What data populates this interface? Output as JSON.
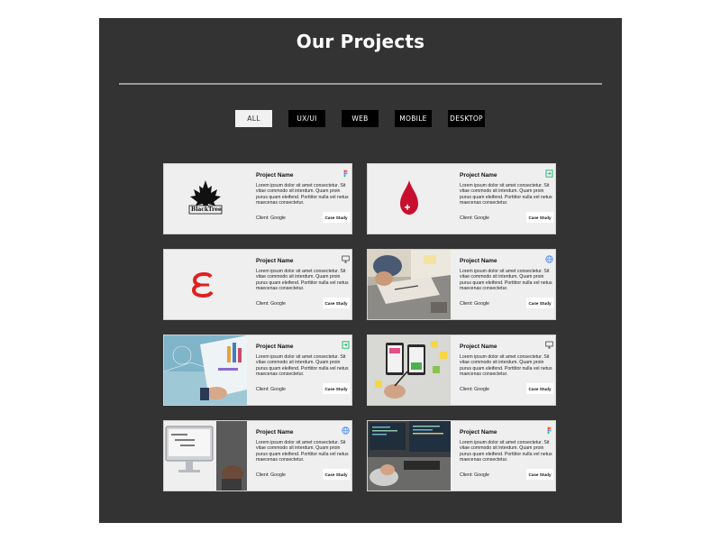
{
  "page": {
    "title": "Our Projects"
  },
  "filters": [
    {
      "label": "ALL",
      "active": true
    },
    {
      "label": "UX/UI",
      "active": false
    },
    {
      "label": "WEB",
      "active": false
    },
    {
      "label": "MOBILE",
      "active": false
    },
    {
      "label": "DESKTOP",
      "active": false
    }
  ],
  "colors": {
    "panel": "#333333",
    "card": "#efefef",
    "figma_red": "#f24e1e",
    "figma_blue": "#1abcfe",
    "figma_green": "#0acf83",
    "maple": "#111111",
    "drop": "#c8102e",
    "e_logo": "#e02020"
  },
  "projects": [
    {
      "name": "Project Name",
      "desc": "Lorem ipsum dolor sit amet consectetur. Sit vitae commodo sit interdum. Quam proin purus quam eleifend. Porttitor nulla vel netus maecenas consectetur.",
      "client": "Client: Google",
      "cta": "Case Study",
      "icon": "figma-icon",
      "thumb": "blacktree-logo",
      "logo_text": "BlackTree"
    },
    {
      "name": "Project Name",
      "desc": "Lorem ipsum dolor sit amet consectetur. Sit vitae commodo sit interdum. Quam proin purus quam eleifend. Porttitor nulla vel netus maecenas consectetur.",
      "client": "Client: Google",
      "cta": "Case Study",
      "icon": "mobile-icon",
      "thumb": "blood-drop-logo"
    },
    {
      "name": "Project Name",
      "desc": "Lorem ipsum dolor sit amet consectetur. Sit vitae commodo sit interdum. Quam proin purus quam eleifend. Porttitor nulla vel netus maecenas consectetur.",
      "client": "Client: Google",
      "cta": "Case Study",
      "icon": "desktop-icon",
      "thumb": "e-logo"
    },
    {
      "name": "Project Name",
      "desc": "Lorem ipsum dolor sit amet consectetur. Sit vitae commodo sit interdum. Quam proin purus quam eleifend. Porttitor nulla vel netus maecenas consectetur.",
      "client": "Client: Google",
      "cta": "Case Study",
      "icon": "globe-icon",
      "thumb": "planning-photo"
    },
    {
      "name": "Project Name",
      "desc": "Lorem ipsum dolor sit amet consectetur. Sit vitae commodo sit interdum. Quam proin purus quam eleifend. Porttitor nulla vel netus maecenas consectetur.",
      "client": "Client: Google",
      "cta": "Case Study",
      "icon": "mobile-icon",
      "thumb": "charts-photo"
    },
    {
      "name": "Project Name",
      "desc": "Lorem ipsum dolor sit amet consectetur. Sit vitae commodo sit interdum. Quam proin purus quam eleifend. Porttitor nulla vel netus maecenas consectetur.",
      "client": "Client: Google",
      "cta": "Case Study",
      "icon": "desktop-icon",
      "thumb": "wireframe-photo"
    },
    {
      "name": "Project Name",
      "desc": "Lorem ipsum dolor sit amet consectetur. Sit vitae commodo sit interdum. Quam proin purus quam eleifend. Porttitor nulla vel netus maecenas consectetur.",
      "client": "Client: Google",
      "cta": "Case Study",
      "icon": "globe-icon",
      "thumb": "desktop-photo"
    },
    {
      "name": "Project Name",
      "desc": "Lorem ipsum dolor sit amet consectetur. Sit vitae commodo sit interdum. Quam proin purus quam eleifend. Porttitor nulla vel netus maecenas consectetur.",
      "client": "Client: Google",
      "cta": "Case Study",
      "icon": "figma-icon",
      "thumb": "coding-photo"
    }
  ]
}
